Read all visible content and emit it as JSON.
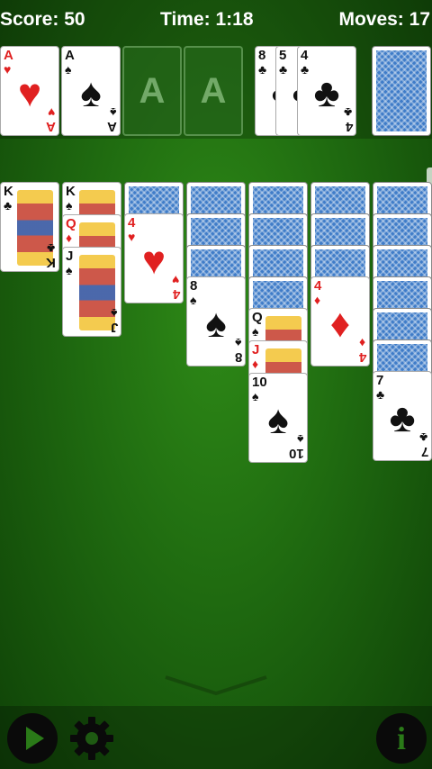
{
  "hud": {
    "score": "Score: 50",
    "time": "Time: 1:18",
    "moves": "Moves: 17"
  },
  "foundations": [
    {
      "rank": "A",
      "suit": "♥",
      "color": "red"
    },
    {
      "rank": "A",
      "suit": "♠",
      "color": "blk"
    },
    {
      "empty_label": "A"
    },
    {
      "empty_label": "A"
    }
  ],
  "waste": [
    {
      "rank": "8",
      "suit": "♣",
      "color": "blk"
    },
    {
      "rank": "5",
      "suit": "♣",
      "color": "blk"
    },
    {
      "rank": "4",
      "suit": "♣",
      "color": "blk"
    }
  ],
  "stock": {
    "icon": "card-back"
  },
  "tableau": [
    {
      "down": 0,
      "up": [
        {
          "rank": "K",
          "suit": "♣",
          "color": "blk",
          "face": true
        }
      ]
    },
    {
      "down": 0,
      "up": [
        {
          "rank": "K",
          "suit": "♠",
          "color": "blk",
          "face": true
        },
        {
          "rank": "Q",
          "suit": "♦",
          "color": "red",
          "face": true
        },
        {
          "rank": "J",
          "suit": "♠",
          "color": "blk",
          "face": true
        }
      ]
    },
    {
      "down": 1,
      "up": [
        {
          "rank": "4",
          "suit": "♥",
          "color": "red"
        }
      ]
    },
    {
      "down": 3,
      "up": [
        {
          "rank": "8",
          "suit": "♠",
          "color": "blk"
        }
      ]
    },
    {
      "down": 4,
      "up": [
        {
          "rank": "Q",
          "suit": "♠",
          "color": "blk",
          "face": true
        },
        {
          "rank": "J",
          "suit": "♦",
          "color": "red",
          "face": true
        },
        {
          "rank": "10",
          "suit": "♠",
          "color": "blk"
        }
      ]
    },
    {
      "down": 3,
      "up": [
        {
          "rank": "4",
          "suit": "♦",
          "color": "red"
        }
      ]
    },
    {
      "down": 6,
      "up": [
        {
          "rank": "7",
          "suit": "♣",
          "color": "blk"
        }
      ]
    }
  ],
  "toolbar": {
    "play": "play-icon",
    "settings": "gear-icon",
    "info": "i"
  }
}
